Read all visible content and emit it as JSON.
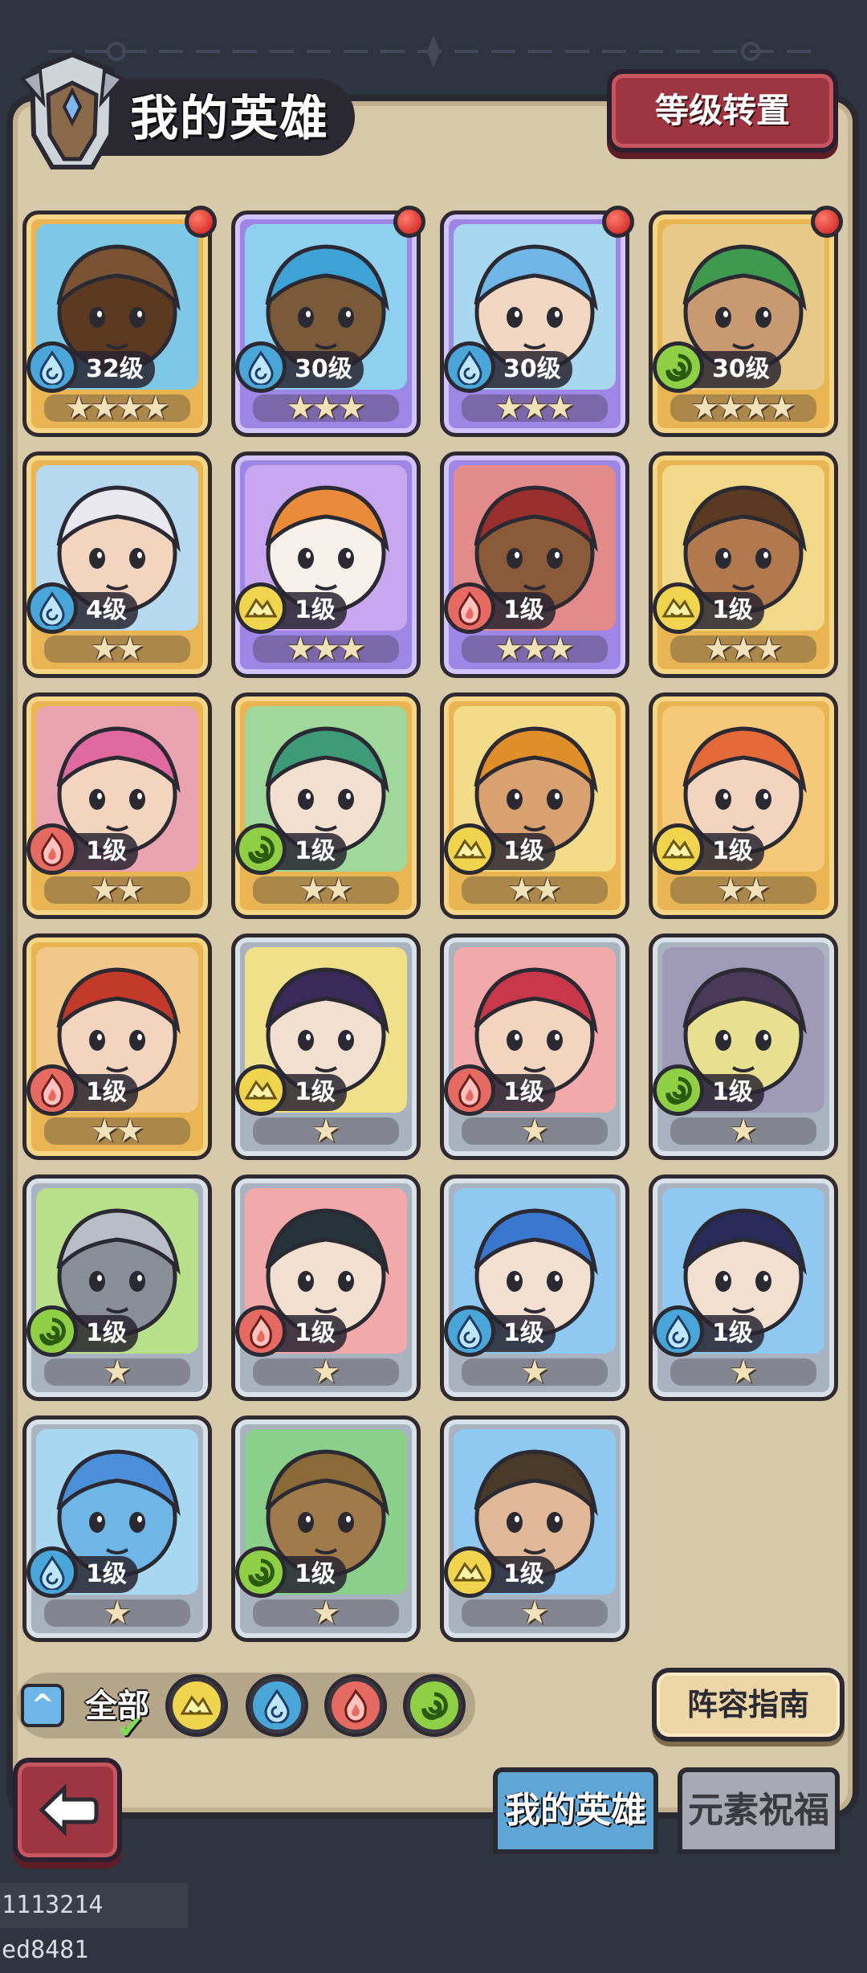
{
  "header": {
    "title": "我的英雄",
    "transfer_label": "等级转置"
  },
  "colors": {
    "water": "#4aa6d9",
    "earth": "#f0d44e",
    "fire": "#e46a62",
    "wind": "#8fcf45"
  },
  "heroes": [
    {
      "level": "32级",
      "stars": 4,
      "element": "water",
      "frame": "gold",
      "dot": true
    },
    {
      "level": "30级",
      "stars": 3,
      "element": "water",
      "frame": "purple",
      "dot": true
    },
    {
      "level": "30级",
      "stars": 3,
      "element": "water",
      "frame": "purple",
      "dot": true
    },
    {
      "level": "30级",
      "stars": 4,
      "element": "wind",
      "frame": "gold",
      "dot": true
    },
    {
      "level": "4级",
      "stars": 2,
      "element": "water",
      "frame": "gold",
      "dot": false
    },
    {
      "level": "1级",
      "stars": 3,
      "element": "earth",
      "frame": "purple",
      "dot": false
    },
    {
      "level": "1级",
      "stars": 3,
      "element": "fire",
      "frame": "purple",
      "dot": false
    },
    {
      "level": "1级",
      "stars": 3,
      "element": "earth",
      "frame": "gold",
      "dot": false
    },
    {
      "level": "1级",
      "stars": 2,
      "element": "fire",
      "frame": "gold",
      "dot": false
    },
    {
      "level": "1级",
      "stars": 2,
      "element": "wind",
      "frame": "gold",
      "dot": false
    },
    {
      "level": "1级",
      "stars": 2,
      "element": "earth",
      "frame": "gold",
      "dot": false
    },
    {
      "level": "1级",
      "stars": 2,
      "element": "earth",
      "frame": "gold",
      "dot": false
    },
    {
      "level": "1级",
      "stars": 2,
      "element": "fire",
      "frame": "gold",
      "dot": false
    },
    {
      "level": "1级",
      "stars": 1,
      "element": "earth",
      "frame": "silver",
      "dot": false
    },
    {
      "level": "1级",
      "stars": 1,
      "element": "fire",
      "frame": "silver",
      "dot": false
    },
    {
      "level": "1级",
      "stars": 1,
      "element": "wind",
      "frame": "silver",
      "dot": false
    },
    {
      "level": "1级",
      "stars": 1,
      "element": "wind",
      "frame": "silver",
      "dot": false
    },
    {
      "level": "1级",
      "stars": 1,
      "element": "fire",
      "frame": "silver",
      "dot": false
    },
    {
      "level": "1级",
      "stars": 1,
      "element": "water",
      "frame": "silver",
      "dot": false
    },
    {
      "level": "1级",
      "stars": 1,
      "element": "water",
      "frame": "silver",
      "dot": false
    },
    {
      "level": "1级",
      "stars": 1,
      "element": "water",
      "frame": "silver",
      "dot": false
    },
    {
      "level": "1级",
      "stars": 1,
      "element": "wind",
      "frame": "silver",
      "dot": false
    },
    {
      "level": "1级",
      "stars": 1,
      "element": "earth",
      "frame": "silver",
      "dot": false
    }
  ],
  "filters": {
    "all_label": "全部",
    "elements": [
      "earth",
      "water",
      "fire",
      "wind"
    ]
  },
  "guide_label": "阵容指南",
  "tabs": {
    "my_heroes": "我的英雄",
    "blessing": "元素祝福"
  },
  "footer_id": "1113214 ed8481"
}
